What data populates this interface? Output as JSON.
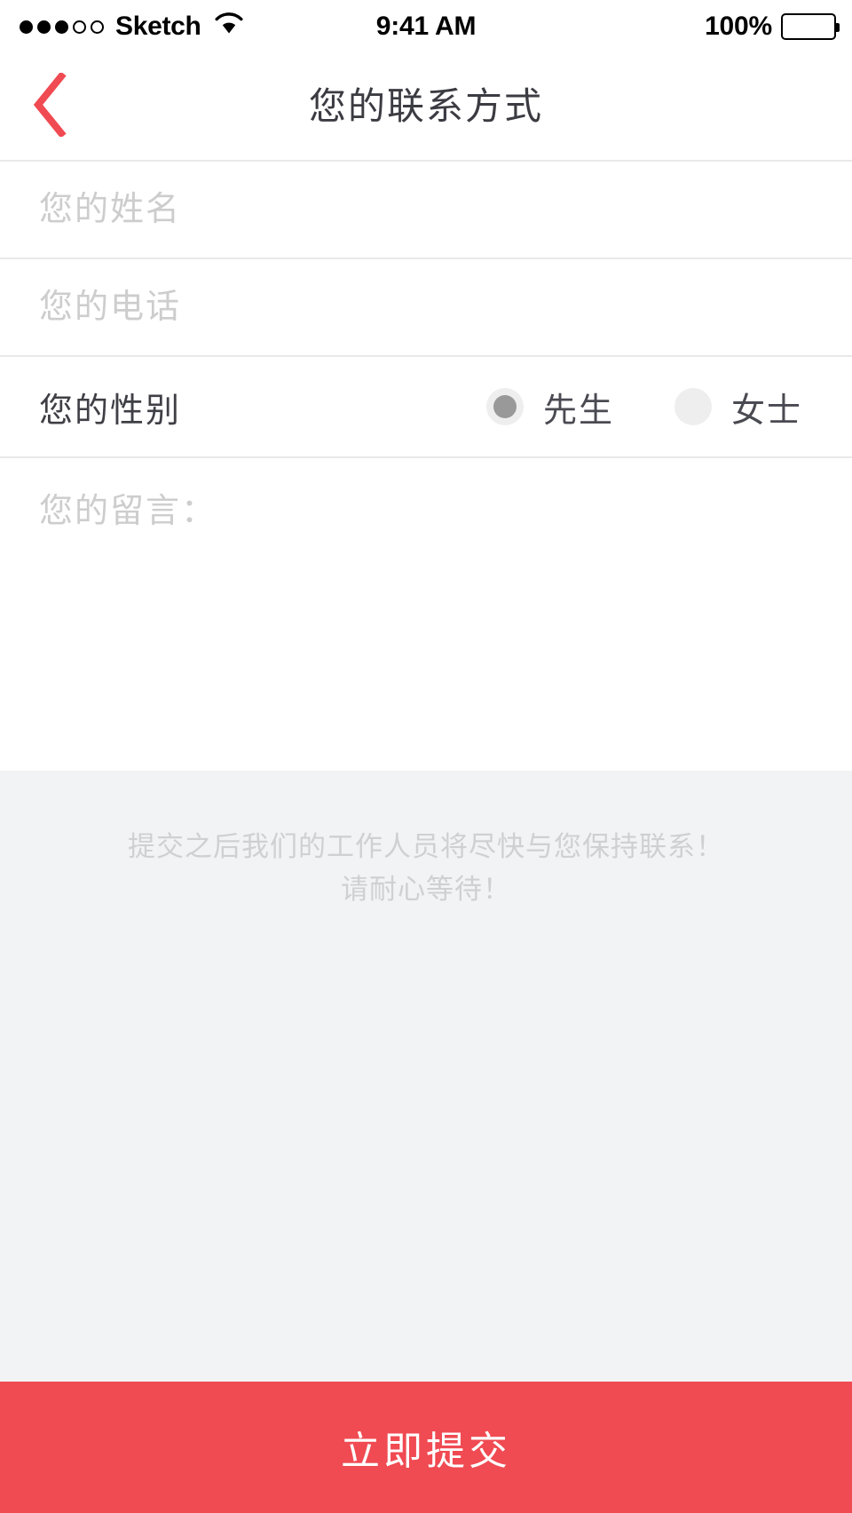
{
  "status_bar": {
    "carrier": "Sketch",
    "signal_dots": [
      "filled",
      "filled",
      "filled",
      "empty",
      "empty"
    ],
    "wifi_icon": "wifi-icon",
    "time": "9:41 AM",
    "battery_percent": "100%",
    "battery_icon": "battery-full-icon"
  },
  "nav": {
    "back_icon": "chevron-left-icon",
    "title": "您的联系方式",
    "accent_color": "#f04a52"
  },
  "form": {
    "name_field": {
      "placeholder": "您的姓名",
      "value": ""
    },
    "phone_field": {
      "placeholder": "您的电话",
      "value": ""
    },
    "gender": {
      "label": "您的性别",
      "options": [
        {
          "label": "先生",
          "selected": true
        },
        {
          "label": "女士",
          "selected": false
        }
      ]
    },
    "message_field": {
      "placeholder": "您的留言：",
      "value": ""
    }
  },
  "hint": {
    "line1": "提交之后我们的工作人员将尽快与您保持联系！",
    "line2": "请耐心等待！"
  },
  "submit": {
    "label": "立即提交",
    "color": "#f04a52"
  }
}
